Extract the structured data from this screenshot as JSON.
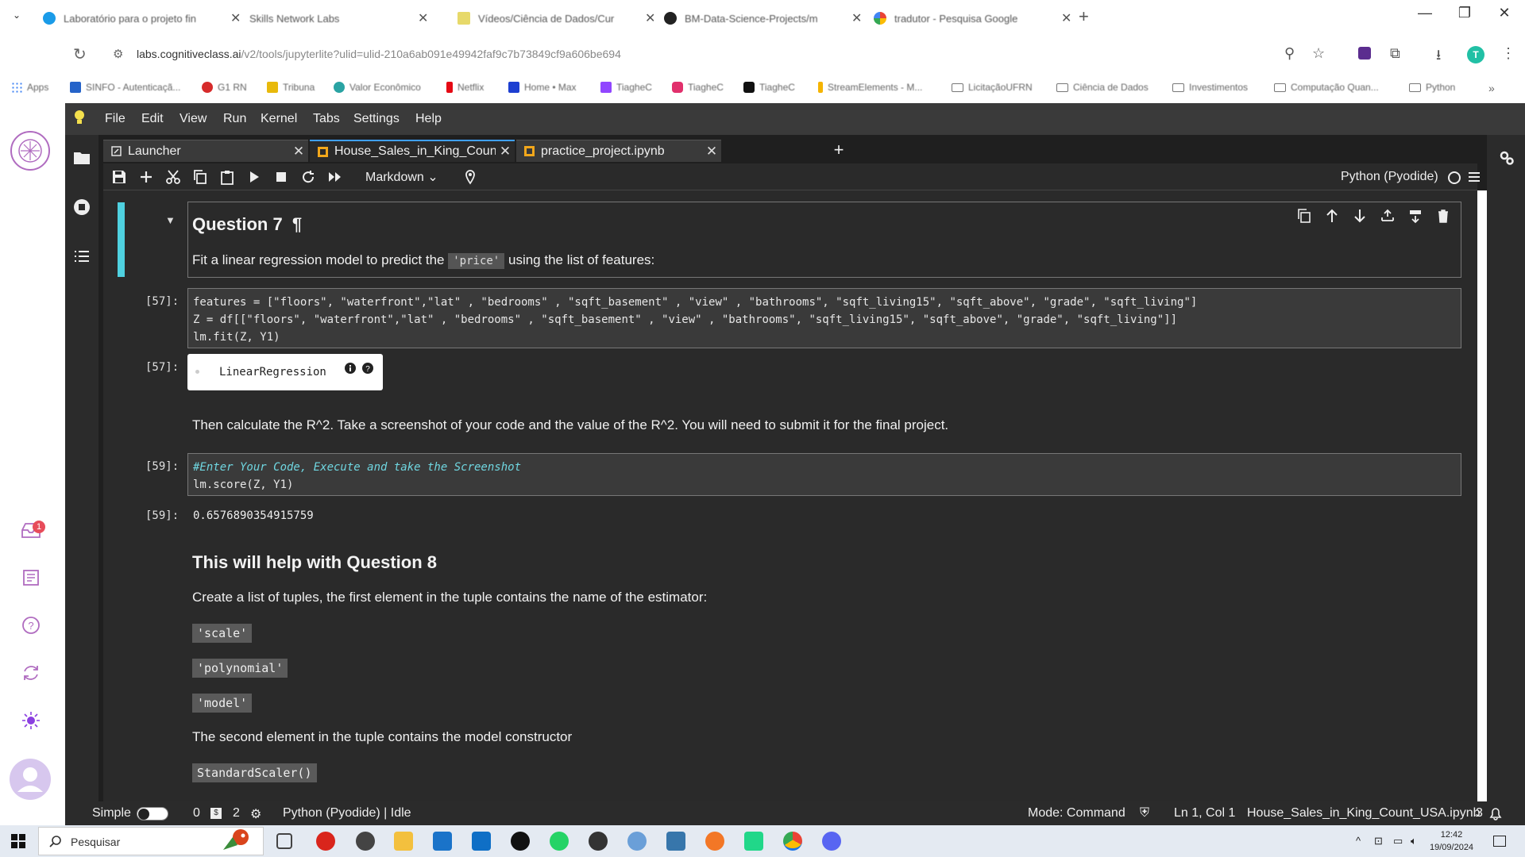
{
  "browser": {
    "tabs": [
      {
        "title": "Laboratório para o projeto fin",
        "color": "#1a9be8"
      },
      {
        "title": "Skills Network Labs",
        "color": "#ffffff"
      },
      {
        "title": "Vídeos/Ciência de Dados/Cur",
        "color": "#e7d96a"
      },
      {
        "title": "BM-Data-Science-Projects/m",
        "color": "#222222"
      },
      {
        "title": "tradutor - Pesquisa Google",
        "color": "#34a853"
      }
    ],
    "url_host": "labs.cognitiveclass.ai",
    "url_path": "/v2/tools/jupyterlite?ulid=ulid-210a6ab091e49942faf9c7b73849cf9a606be694",
    "avatar_letter": "T",
    "bookmarks": [
      {
        "label": "Apps",
        "kind": "apps"
      },
      {
        "label": "SINFO - Autenticaçã...",
        "kind": "site",
        "color": "#2563c9"
      },
      {
        "label": "G1 RN",
        "kind": "site",
        "color": "#d62b2b"
      },
      {
        "label": "Tribuna",
        "kind": "site",
        "color": "#e8b90b"
      },
      {
        "label": "Valor Econômico",
        "kind": "site",
        "color": "#2aa3a3"
      },
      {
        "label": "Netflix",
        "kind": "site",
        "color": "#e50914"
      },
      {
        "label": "Home • Max",
        "kind": "site",
        "color": "#1d3fd1"
      },
      {
        "label": "TiagheC",
        "kind": "site",
        "color": "#9146ff"
      },
      {
        "label": "TiagheC",
        "kind": "site",
        "color": "#e1306c"
      },
      {
        "label": "TiagheC",
        "kind": "site",
        "color": "#111111"
      },
      {
        "label": "StreamElements - M...",
        "kind": "site",
        "color": "#f5b400"
      },
      {
        "label": "LicitaçãoUFRN",
        "kind": "folder"
      },
      {
        "label": "Ciência de Dados",
        "kind": "folder"
      },
      {
        "label": "Investimentos",
        "kind": "folder"
      },
      {
        "label": "Computação Quan...",
        "kind": "folder"
      },
      {
        "label": "Python",
        "kind": "folder"
      }
    ],
    "bookmarks_more": "»"
  },
  "jupyter": {
    "menu": [
      "File",
      "Edit",
      "View",
      "Run",
      "Kernel",
      "Tabs",
      "Settings",
      "Help"
    ],
    "doc_tabs": [
      {
        "label": "Launcher",
        "active": false
      },
      {
        "label": "House_Sales_in_King_Count_",
        "active": true
      },
      {
        "label": "practice_project.ipynb",
        "active": false
      }
    ],
    "cell_type": "Markdown",
    "kernel": "Python (Pyodide)",
    "notebook": {
      "q7_heading": "Question 7",
      "q7_anchor": "¶",
      "q7_text_before": "Fit a linear regression model to predict the",
      "q7_code": "'price'",
      "q7_text_after": "using the list of features:",
      "cell57_prompt": "[57]:",
      "cell57_lines": [
        "features = [\"floors\", \"waterfront\",\"lat\" , \"bedrooms\" , \"sqft_basement\" , \"view\" , \"bathrooms\", \"sqft_living15\", \"sqft_above\", \"grade\", \"sqft_living\"]",
        "Z = df[[\"floors\", \"waterfront\",\"lat\" , \"bedrooms\" , \"sqft_basement\" , \"view\" , \"bathrooms\", \"sqft_living15\", \"sqft_above\", \"grade\", \"sqft_living\"]]",
        "lm.fit(Z, Y1)"
      ],
      "out57_prompt": "[57]:",
      "out57_widget": "LinearRegression",
      "r2_text": "Then calculate the R^2. Take a screenshot of your code and the value of the R^2. You will need to submit it for the final project.",
      "cell59_prompt": "[59]:",
      "cell59_comment": "#Enter Your Code, Execute and take the Screenshot",
      "cell59_code": "lm.score(Z, Y1)",
      "out59_prompt": "[59]:",
      "out59_value": "0.6576890354915759",
      "q8_heading": "This will help with Question 8",
      "q8_text": "Create a list of tuples, the first element in the tuple contains the name of the estimator:",
      "estimators": [
        "'scale'",
        "'polynomial'",
        "'model'"
      ],
      "second_text": "The second element in the tuple contains the model constructor",
      "constructor": "StandardScaler()"
    },
    "status": {
      "simple": "Simple",
      "count_a": "0",
      "count_b": "2",
      "kernel_state": "Python (Pyodide) | Idle",
      "mode": "Mode: Command",
      "position": "Ln 1, Col 1",
      "file": "House_Sales_in_King_Count_USA.ipynb",
      "notif_count": "3"
    },
    "left_badge": "1"
  },
  "taskbar": {
    "search_placeholder": "Pesquisar",
    "time": "12:42",
    "date": "19/09/2024"
  }
}
